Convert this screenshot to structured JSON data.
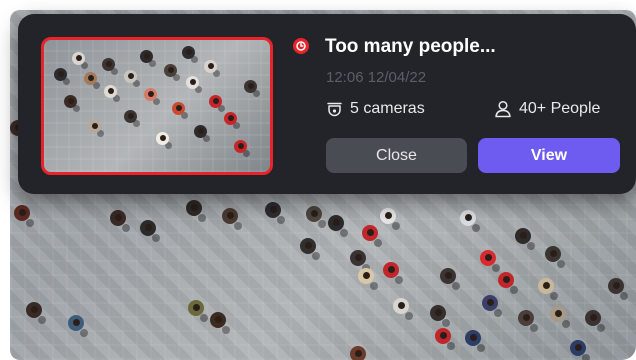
{
  "notification": {
    "title": "Too many people...",
    "timestamp": "12:06 12/04/22",
    "cameras_label": "5 cameras",
    "people_label": "40+ People",
    "close_label": "Close",
    "view_label": "View"
  },
  "icons": {
    "alert": "clock-alert-icon",
    "cameras": "camera-icon",
    "people": "person-icon"
  },
  "colors": {
    "card_background": "#23242a",
    "alert_red": "#e8242a",
    "view_button": "#6e5cf0",
    "close_button": "#4a4c53",
    "timestamp_text": "#5c5f68"
  }
}
